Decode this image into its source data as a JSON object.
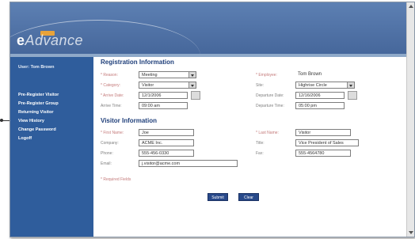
{
  "app": {
    "logo_e": "e",
    "logo_rest": "Advance"
  },
  "sidebar": {
    "user": "User: Tom Brown",
    "items": [
      {
        "label": "Pre-Register Visitor"
      },
      {
        "label": "Pre-Register Group"
      },
      {
        "label": "Returning Visitor"
      },
      {
        "label": "View History"
      },
      {
        "label": "Change Password"
      },
      {
        "label": "Logoff"
      }
    ]
  },
  "registration": {
    "title": "Registration Information",
    "reason_label": "* Reason:",
    "reason_value": "Meeting",
    "category_label": "* Category:",
    "category_value": "Visitor",
    "arrive_date_label": "* Arrive Date:",
    "arrive_date_value": "12/1/2006",
    "arrive_time_label": "Arrive Time:",
    "arrive_time_value": "09:00 am",
    "employee_label": "* Employee:",
    "employee_value": "Tom Brown",
    "site_label": "Site:",
    "site_value": "Highrise Circle",
    "depart_date_label": "Departure Date:",
    "depart_date_value": "12/16/2006",
    "depart_time_label": "Departure Time:",
    "depart_time_value": "05:00 pm"
  },
  "visitor": {
    "title": "Visitor Information",
    "first_name_label": "* First Name:",
    "first_name_value": "Joe",
    "company_label": "Company:",
    "company_value": "ACME Inc.",
    "phone_label": "Phone:",
    "phone_value": "555-456-0330",
    "email_label": "Email:",
    "email_value": "j.visitor@acme.com",
    "last_name_label": "* Last Name:",
    "last_name_value": "Visitor",
    "title_label": "Title:",
    "title_value": "Vice President of Sales",
    "fax_label": "Fax:",
    "fax_value": "555-4564780"
  },
  "footer": {
    "required_note": "* Required Fields",
    "submit_label": "Submit",
    "clear_label": "Clear"
  }
}
